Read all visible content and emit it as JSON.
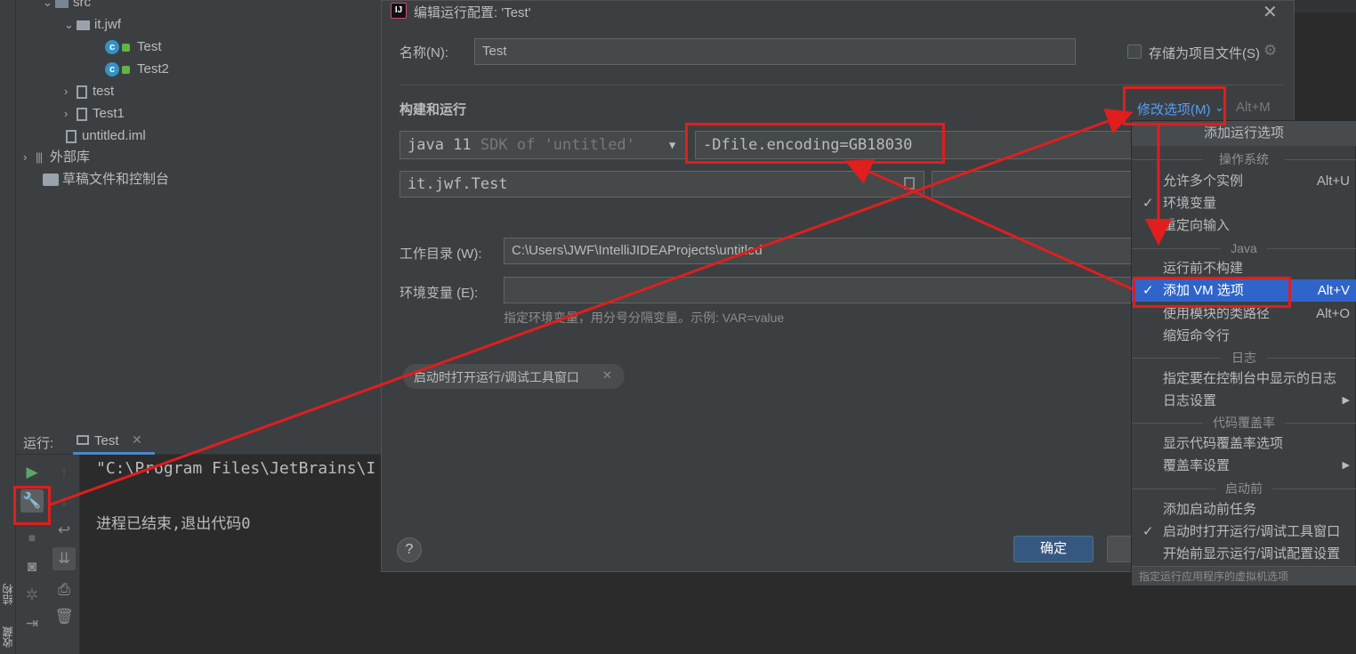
{
  "left_strip": {
    "tab_structure": "结构",
    "tab_bookmarks": "收藏"
  },
  "tree": {
    "src": "src",
    "package": "it.jwf",
    "class1": "Test",
    "class2": "Test2",
    "test": "test",
    "test1": "Test1",
    "iml": "untitled.iml",
    "external": "外部库",
    "scratches": "草稿文件和控制台"
  },
  "run": {
    "label": "运行:",
    "tab": "Test",
    "line1": "\"C:\\Program Files\\JetBrains\\I",
    "line2": "进程已结束,退出代码0"
  },
  "dialog": {
    "title": "编辑运行配置: 'Test'",
    "name_label": "名称(N):",
    "name_value": "Test",
    "store_label": "存储为项目文件(S)",
    "section": "构建和运行",
    "modify": "修改选项(M)",
    "modify_shortcut": "Alt+M",
    "jdk_main": "java 11",
    "jdk_sub": "SDK of 'untitled'",
    "vm_options": "-Dfile.encoding=GB18030",
    "main_class": "it.jwf.Test",
    "workdir_label": "工作目录 (W):",
    "workdir_value": "C:\\Users\\JWF\\IntelliJIDEAProjects\\untitled",
    "env_label": "环境变量 (E):",
    "env_hint": "指定环境变量，用分号分隔变量。示例: VAR=value",
    "chip": "启动时打开运行/调试工具窗口",
    "help": "?",
    "ok": "确定"
  },
  "popup": {
    "title": "添加运行选项",
    "sec_os": "操作系统",
    "multi": "允许多个实例",
    "multi_sc": "Alt+U",
    "env": "环境变量",
    "redirect": "重定向输入",
    "sec_java": "Java",
    "nobuild": "运行前不构建",
    "vm": "添加 VM 选项",
    "vm_sc": "Alt+V",
    "module_cp": "使用模块的类路径",
    "module_cp_sc": "Alt+O",
    "shorten": "缩短命令行",
    "sec_log": "日志",
    "console_log": "指定要在控制台中显示的日志",
    "log_settings": "日志设置",
    "sec_cov": "代码覆盖率",
    "show_cov": "显示代码覆盖率选项",
    "cov_settings": "覆盖率设置",
    "sec_before": "启动前",
    "add_task": "添加启动前任务",
    "open_window": "启动时打开运行/调试工具窗口",
    "show_settings": "开始前显示运行/调试配置设置",
    "footer": "指定运行应用程序的虚拟机选项"
  },
  "colors": {
    "annotation": "#e01e1e",
    "accent": "#4b8bd6",
    "selected": "#2f65ca"
  }
}
